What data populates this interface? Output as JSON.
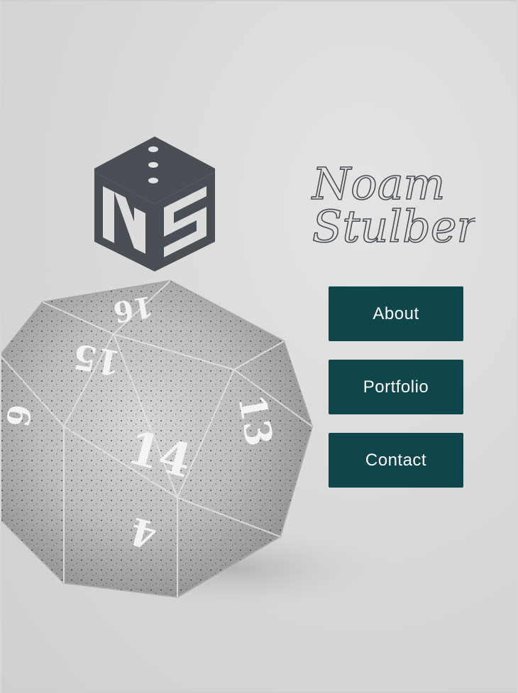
{
  "brand": {
    "name_line1": "Noam",
    "name_line2": "Stulberg",
    "logo_icon": "ns-dice-logo-icon"
  },
  "nav": {
    "items": [
      {
        "label": "About"
      },
      {
        "label": "Portfolio"
      },
      {
        "label": "Contact"
      }
    ]
  },
  "colors": {
    "button_bg": "#0f464b",
    "button_text": "#ffffff",
    "logo_color": "#4a4f55"
  },
  "hero": {
    "icon": "d20-glitter-die-photo",
    "die_numbers": [
      "16",
      "15",
      "13",
      "14",
      "4"
    ]
  }
}
